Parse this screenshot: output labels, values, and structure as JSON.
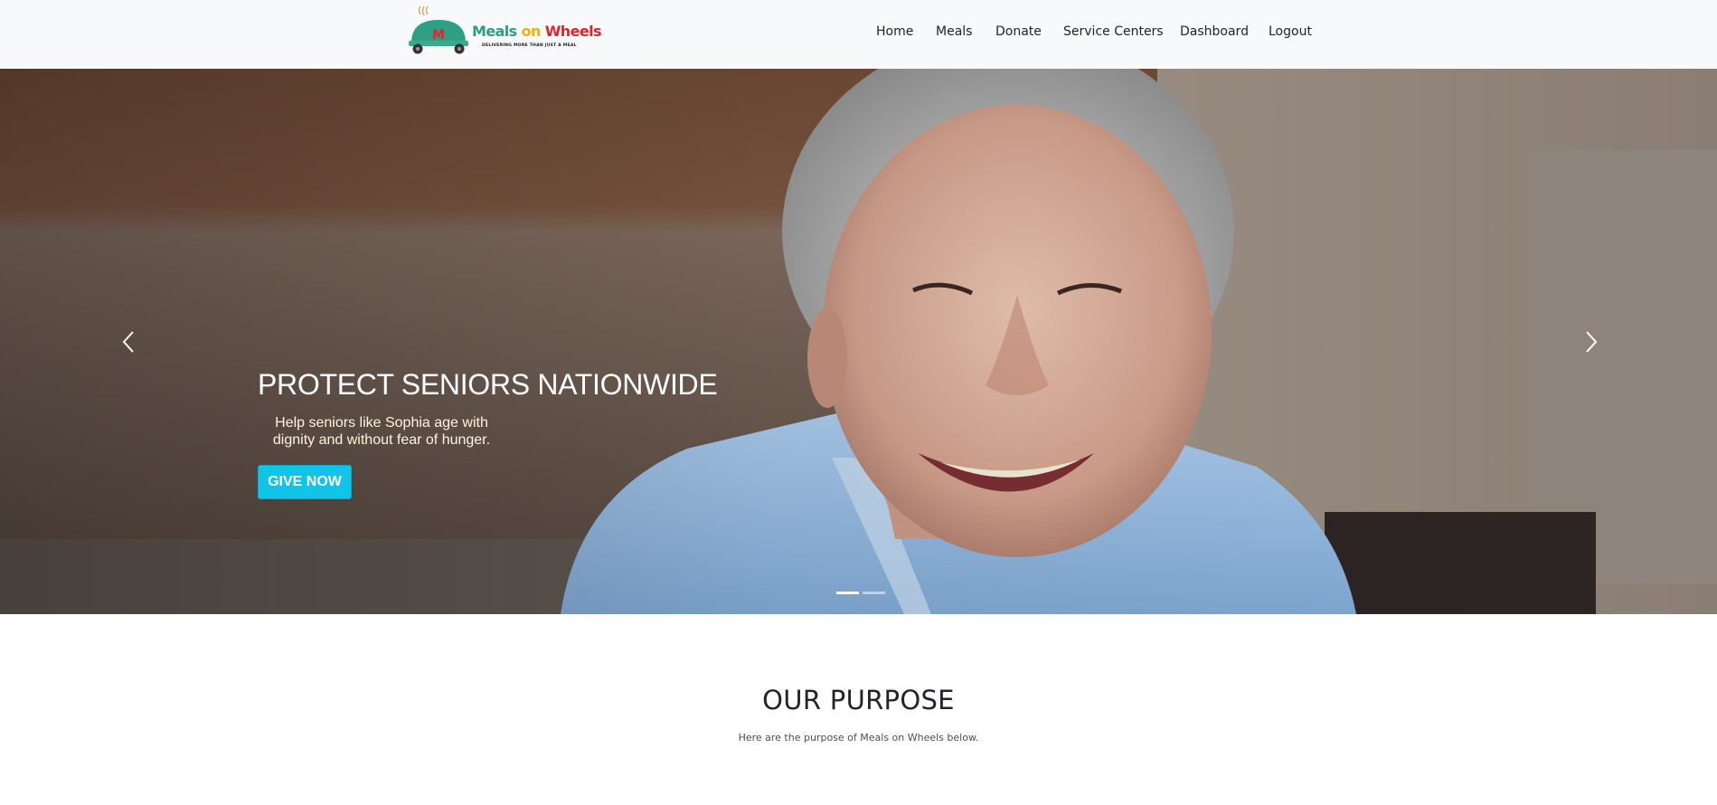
{
  "brand": {
    "name_part1": "Meals",
    "name_part2": "on",
    "name_part3": "Wheels",
    "tagline": "DELIVERING MORE THAN JUST A MEAL",
    "logo_letter": "M",
    "colors": {
      "green": "#2e9e84",
      "yellow": "#f0b400",
      "red": "#e3232c"
    }
  },
  "nav": {
    "items": [
      {
        "label": "Home",
        "icon": ""
      },
      {
        "label": "Meals",
        "icon": ""
      },
      {
        "label": "Donate",
        "icon": ""
      },
      {
        "label": "Service Centers",
        "icon": ""
      },
      {
        "label": "Dashboard",
        "icon": ""
      },
      {
        "label": "Logout",
        "icon": ""
      }
    ]
  },
  "hero": {
    "title": "PROTECT SENIORS NATIONWIDE",
    "text": "Help seniors like Sophia age with dignity and without fear of hunger.",
    "button_label": "GIVE NOW",
    "button_color": "#10c4e8",
    "prev_icon": "chevron-left-icon",
    "next_icon": "chevron-right-icon",
    "slides": {
      "active": 1,
      "total": 2
    }
  },
  "purpose": {
    "title": "OUR PURPOSE",
    "subtitle": "Here are the purpose of Meals on Wheels below."
  }
}
